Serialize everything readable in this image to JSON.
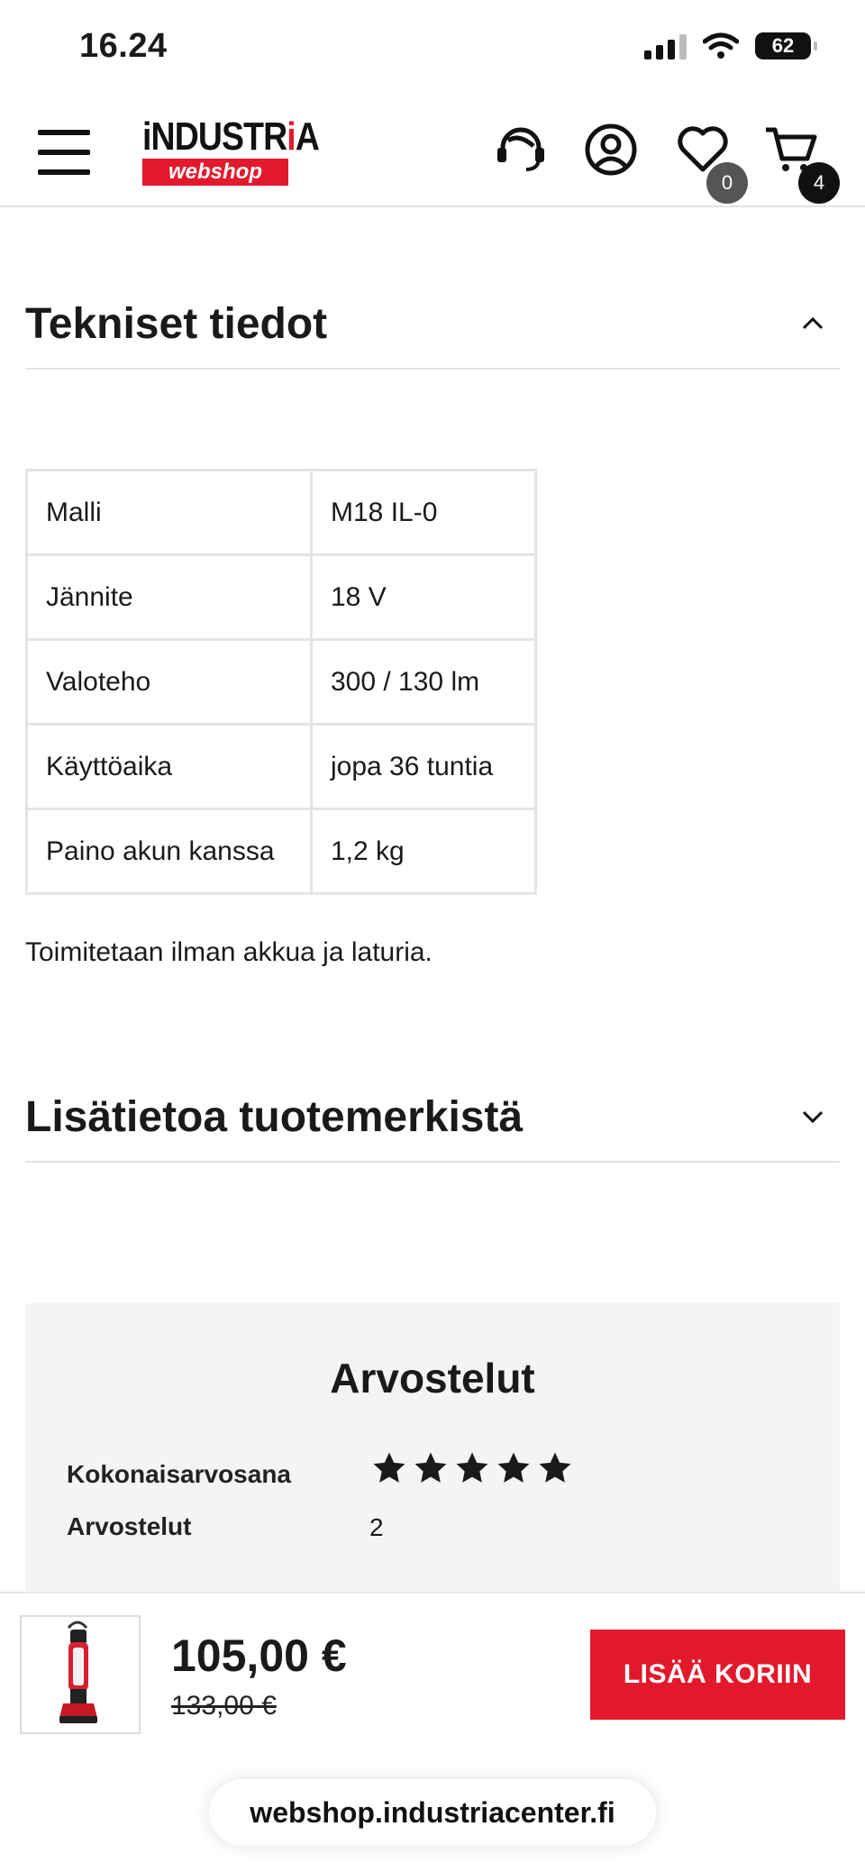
{
  "status_bar": {
    "time": "16.24",
    "battery": "62"
  },
  "header": {
    "logo_top_black": "iNDUSTR",
    "logo_top_red": "i",
    "logo_top_end": "A",
    "logo_bottom": "webshop",
    "wishlist_count": "0",
    "cart_count": "4",
    "icons": [
      "menu-icon",
      "support-headset-icon",
      "user-account-icon",
      "heart-icon",
      "cart-icon"
    ]
  },
  "tech_section": {
    "title": "Tekniset tiedot",
    "expanded": true
  },
  "spec_table": [
    {
      "key": "Malli",
      "value": "M18 IL-0"
    },
    {
      "key": "Jännite",
      "value": "18 V"
    },
    {
      "key": "Valoteho",
      "value": "300 / 130 lm"
    },
    {
      "key": "Käyttöaika",
      "value": "jopa 36 tuntia"
    },
    {
      "key": "Paino akun kanssa",
      "value": "1,2 kg"
    }
  ],
  "note": "Toimitetaan ilman akkua ja laturia.",
  "brand_section": {
    "title": "Lisätietoa tuotemerkistä",
    "expanded": false
  },
  "reviews": {
    "title": "Arvostelut",
    "overall_label": "Kokonaisarvosana",
    "rating": 5,
    "rating_max": 5,
    "count_label": "Arvostelut",
    "count": "2"
  },
  "bottom_bar": {
    "price": "105,00 €",
    "old_price": "133,00 €",
    "add_to_cart": "LISÄÄ KORIIN",
    "url": "webshop.industriacenter.fi"
  },
  "colors": {
    "accent": "#e2192c",
    "badge_grey": "#555555",
    "badge_black": "#111111",
    "review_bg": "#f4f4f4"
  }
}
